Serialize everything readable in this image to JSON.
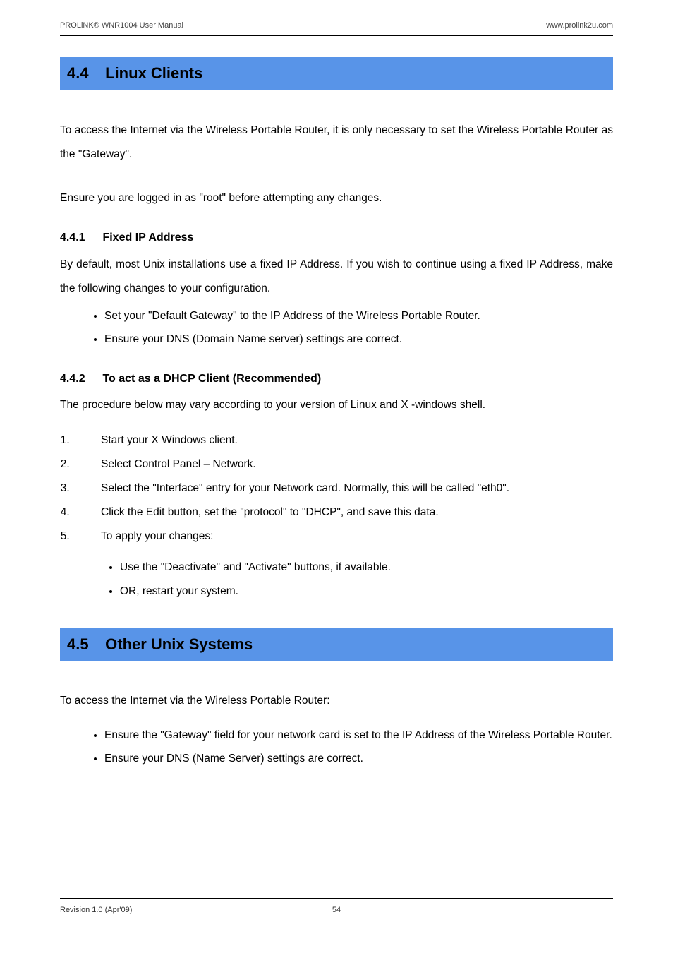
{
  "header": {
    "left": "PROLiNK® WNR1004 User Manual",
    "right": "www.prolink2u.com"
  },
  "section_44": {
    "number": "4.4",
    "title": "Linux Clients",
    "para1": "To access the Internet via the Wireless Portable Router, it is only necessary to set the Wireless Portable Router as the \"Gateway\".",
    "para2": "Ensure you are logged in as \"root\" before attempting any changes."
  },
  "section_441": {
    "number": "4.4.1",
    "title": "Fixed IP Address",
    "para1": "By default, most Unix installations use a fixed IP Address. If you wish to continue using a fixed IP Address, make the following changes to your configuration.",
    "bullets": [
      "Set your \"Default Gateway\" to the IP Address of the Wireless Portable Router.",
      "Ensure your DNS (Domain Name server) settings are correct."
    ]
  },
  "section_442": {
    "number": "4.4.2",
    "title": "To act as a DHCP Client (Recommended)",
    "para1": "The procedure below may vary according to your version of Linux and X -windows shell.",
    "steps": [
      "Start your X Windows client.",
      "Select Control Panel – Network.",
      "Select the \"Interface\" entry for your Network card. Normally, this will be called \"eth0\".",
      "Click the Edit button, set the \"protocol\" to \"DHCP\", and save this data.",
      "To apply your changes:"
    ],
    "sub_bullets": [
      "Use the \"Deactivate\" and \"Activate\" buttons, if available.",
      "OR, restart your system."
    ]
  },
  "section_45": {
    "number": "4.5",
    "title": "Other Unix Systems",
    "para1": "To access the Internet via the Wireless Portable Router:",
    "bullets": [
      "Ensure the \"Gateway\" field for your network card is set to the IP Address of the Wireless Portable Router.",
      "Ensure your DNS (Name Server) settings are correct."
    ]
  },
  "footer": {
    "revision": "Revision 1.0 (Apr'09)",
    "page": "54"
  }
}
